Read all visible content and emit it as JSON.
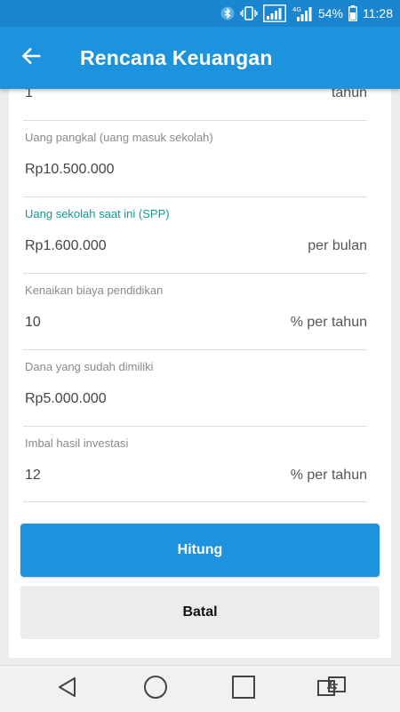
{
  "status_bar": {
    "battery_percent": "54%",
    "time": "11:28",
    "icons": [
      "bluetooth-icon",
      "vibrate-icon",
      "signal-icon",
      "data-signal-icon",
      "battery-icon"
    ]
  },
  "app_bar": {
    "title": "Rencana Keuangan",
    "back_icon": "arrow-left-icon"
  },
  "form": {
    "fields": [
      {
        "label": "",
        "value": "1",
        "suffix": "tahun",
        "active": false
      },
      {
        "label": "Uang pangkal (uang masuk sekolah)",
        "value": "Rp10.500.000",
        "suffix": "",
        "active": false
      },
      {
        "label": "Uang sekolah saat ini (SPP)",
        "value": "Rp1.600.000",
        "suffix": "per bulan",
        "active": true
      },
      {
        "label": "Kenaikan biaya pendidikan",
        "value": "10",
        "suffix": "% per tahun",
        "active": false
      },
      {
        "label": "Dana yang sudah dimiliki",
        "value": "Rp5.000.000",
        "suffix": "",
        "active": false
      },
      {
        "label": "Imbal hasil investasi",
        "value": "12",
        "suffix": "% per tahun",
        "active": false
      }
    ]
  },
  "buttons": {
    "calculate_label": "Hitung",
    "cancel_label": "Batal"
  },
  "nav_bar": {
    "icons": [
      "back-triangle-icon",
      "home-circle-icon",
      "recents-square-icon",
      "dual-window-icon"
    ]
  },
  "colors": {
    "primary": "#1e93dd",
    "status_bar": "#1a86cf",
    "active_label": "#14998f",
    "background": "#ececec"
  }
}
